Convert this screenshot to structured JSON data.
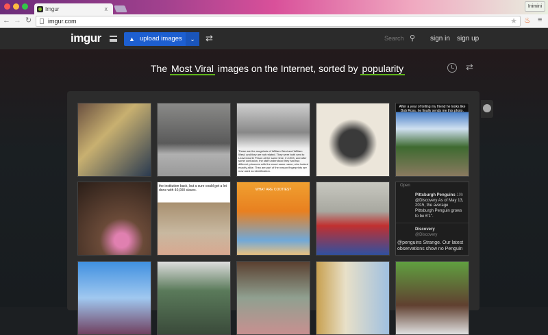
{
  "browser": {
    "tab_title": "Imgur",
    "tab_close": "x",
    "url": "imgur.com",
    "user": "Inimini"
  },
  "header": {
    "logo": "imgur",
    "upload_label": "upload images",
    "search_placeholder": "Search",
    "sign_in": "sign in",
    "sign_up": "sign up"
  },
  "tagline": {
    "pre": "The",
    "sort_section": "Most Viral",
    "mid": "images on the Internet, sorted by",
    "sort_by": "popularity"
  },
  "thumbs": [
    {
      "bg": "linear-gradient(135deg,#6a5040,#c8b070 40%,#2a3a50)"
    },
    {
      "bg": "linear-gradient(180deg,#8a8a88 0%,#5a5a5a 55%,#b0b0b0 70%,#999 100%)"
    },
    {
      "bg": "linear-gradient(180deg,#cfcfcf 0%,#888 40%,#eee 62%,#fff 100%)",
      "caption": "These are the mugshots of William West and William West, and they are not related. They were both sent to Leavenworth Prison at the same time. In 1903, and after some confusion, the staff understood they had two different prisoners with the exact same name, who looked exactly alike. They are part of the reason fingerprints are now used as identification."
    },
    {
      "bg": "radial-gradient(circle at 50% 55%,#3a3a3a 0 25%,#ece6da 45%)"
    },
    {
      "bg": "linear-gradient(180deg,#111 0 12%,#4a80c8 12%,#cfe0f0 35%,#3e6a30 60%,#8a7a60 100%)",
      "caption": "After a year of telling my friend he looks like Bob Ross, he finally sends me this photo."
    },
    {
      "bg": "radial-gradient(circle at 60% 80%,#e080b0 0 10%,#6a4a38 30%,#2a1e18 100%)"
    },
    {
      "bg": "linear-gradient(180deg,#fff 0 28%,#a89070 28%,#c8b8a0 70%,#d8a890 100%)",
      "caption": "the institution back, but a sure could get a lot done with 40,000 slaves."
    },
    {
      "bg": "linear-gradient(180deg,#f0a030,#e88020 40%,#70a8d8 80%,#e8c080)",
      "caption": "WHAT ARE COOTIES?"
    },
    {
      "bg": "linear-gradient(180deg,#c8c8c0 0%,#a8a8a0 40%,#c03030 60%,#3050a0 100%)"
    },
    {
      "bg": "#1e1e1e",
      "tweet": {
        "open": "Open",
        "name": "Pittsburgh Penguins",
        "time": "19h",
        "text": "@Discovery As of May 13, 2015, the average Pittsburgh Penguin grows to be 6'1\".",
        "name2": "Discovery",
        "handle2": "@Discovery",
        "text2": "@penguins Strange. Our latest observations show no Penguin"
      }
    },
    {
      "bg": "linear-gradient(180deg,#4090e0,#a0c8f0 50%,#704060 100%)"
    },
    {
      "bg": "linear-gradient(180deg,#ddd,#5a7a5a 40%,#3a4a3a)"
    },
    {
      "bg": "linear-gradient(180deg,#5a4030,#90a090 50%,#c89090)"
    },
    {
      "bg": "linear-gradient(90deg,#c8a050,#e8e0c8 40%,#a0c0e0)"
    },
    {
      "bg": "linear-gradient(180deg,#60a040,#604030 60%,#e0e0e0)"
    }
  ]
}
